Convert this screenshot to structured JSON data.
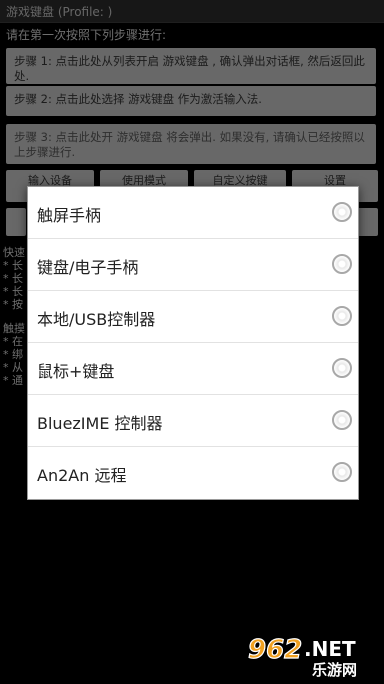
{
  "app": {
    "title": "游戏键盘 (Profile: )"
  },
  "instructions": "请在第一次按照下列步骤进行:",
  "steps": [
    "步骤 1: 点击此处从列表开启 游戏键盘 , 确认弹出对话框, 然后返回此处.",
    "步骤 2: 点击此处选择 游戏键盘 作为激活输入法.",
    "步骤 3: 点击此处开 游戏键盘 将会弹出. 如果没有, 请确认已经按照以上步骤进行."
  ],
  "buttons": [
    "输入设备",
    "使用模式",
    "自定义按键",
    "设置"
  ],
  "background": {
    "section1": [
      "快速",
      "* 长",
      "* 长",
      "* 长",
      "* 按"
    ],
    "section2": [
      "触摸",
      "* 在",
      "* 绑",
      "* 从",
      "* 通"
    ]
  },
  "dialog": {
    "options": [
      {
        "label": "触屏手柄",
        "selected": false
      },
      {
        "label": "键盘/电子手柄",
        "selected": false
      },
      {
        "label": "本地/USB控制器",
        "selected": false
      },
      {
        "label": "鼠标+键盘",
        "selected": false
      },
      {
        "label": "BluezIME 控制器",
        "selected": false
      },
      {
        "label": "An2An 远程",
        "selected": false
      }
    ]
  },
  "watermark": {
    "number": "962",
    "suffix": ".NET",
    "cn": "乐游网"
  },
  "colors": {
    "accent": "#f0a020",
    "brand": "#e06010"
  }
}
